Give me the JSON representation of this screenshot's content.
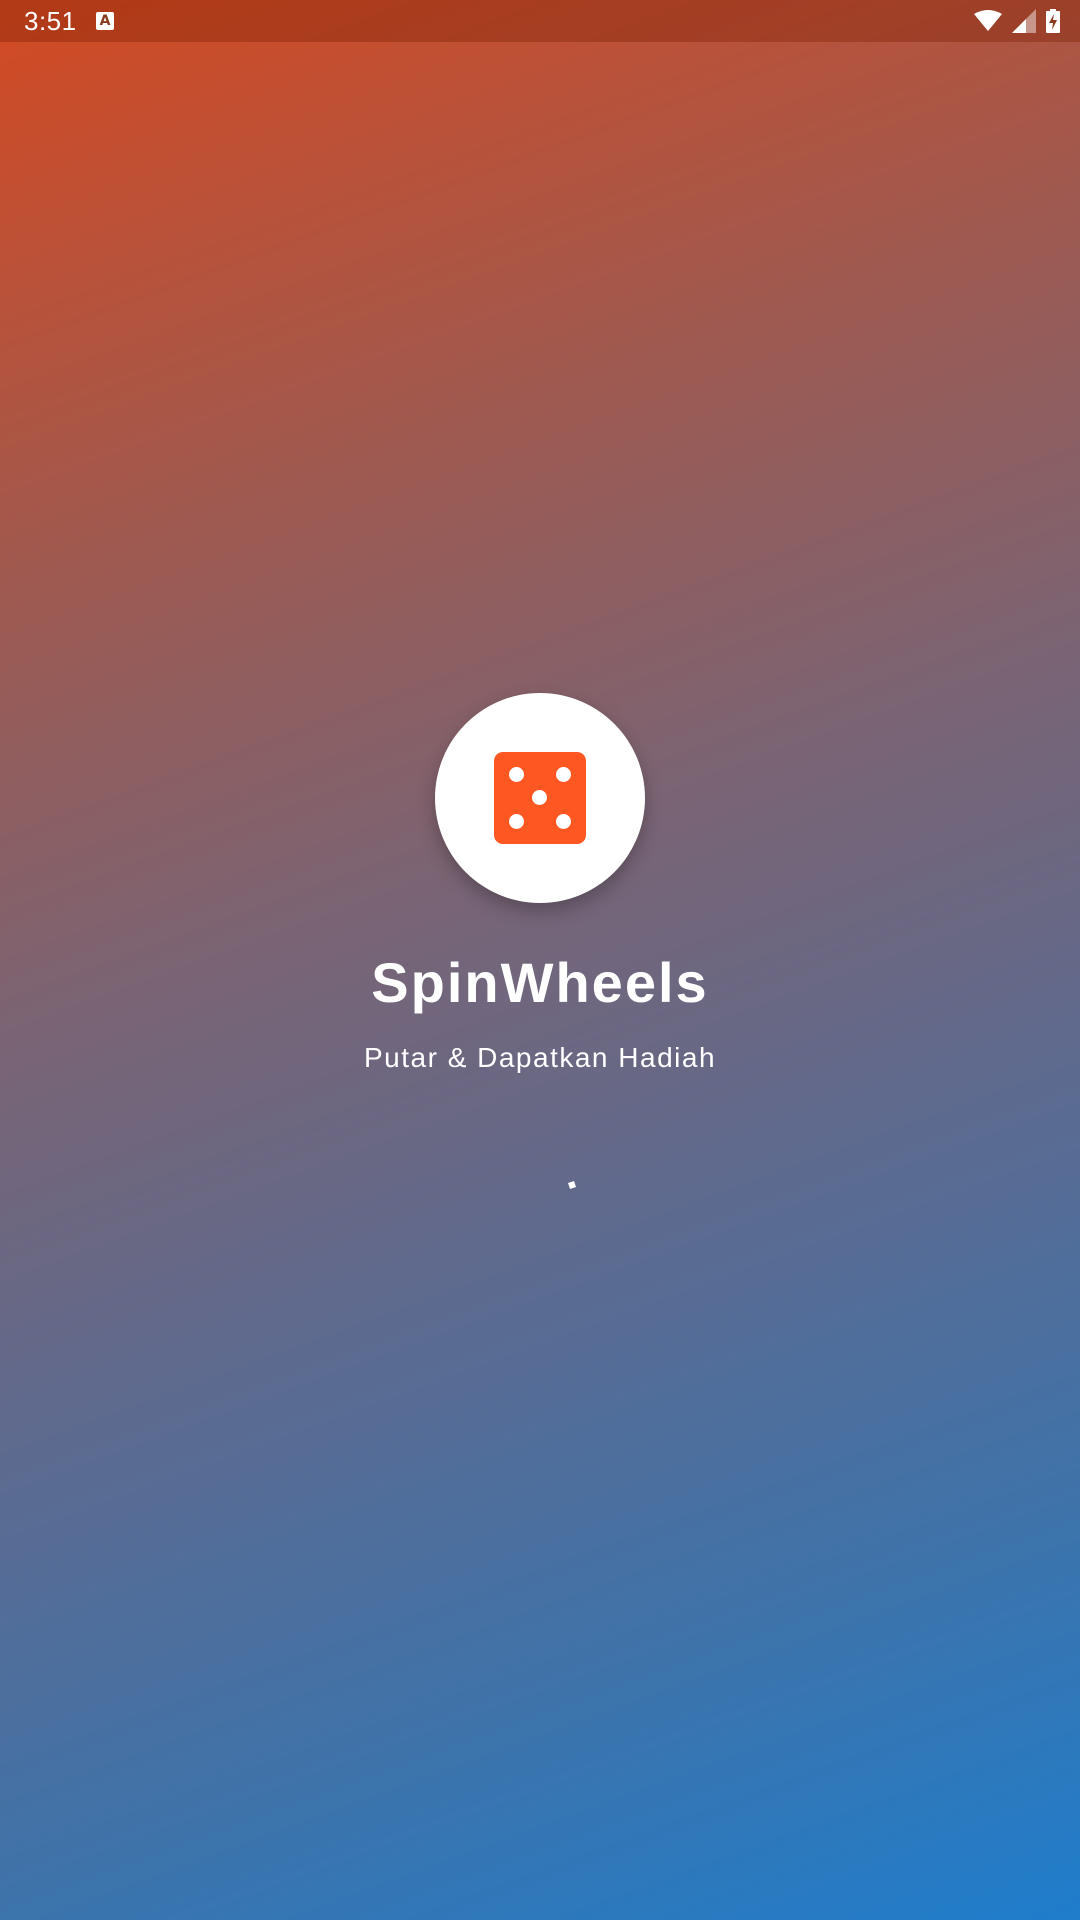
{
  "status_bar": {
    "time": "3:51",
    "notification_icon": "text-a-icon",
    "icons": [
      "wifi-icon",
      "cellular-signal-icon",
      "battery-charging-icon"
    ]
  },
  "splash": {
    "logo_icon": "dice-five-icon",
    "title": "SpinWheels",
    "subtitle": "Putar & Dapatkan Hadiah",
    "loading_indicator": "spinner-icon"
  },
  "colors": {
    "gradient_start": "#d34a22",
    "gradient_end": "#1f7dcc",
    "dice": "#fe5722",
    "text": "#ffffff"
  }
}
